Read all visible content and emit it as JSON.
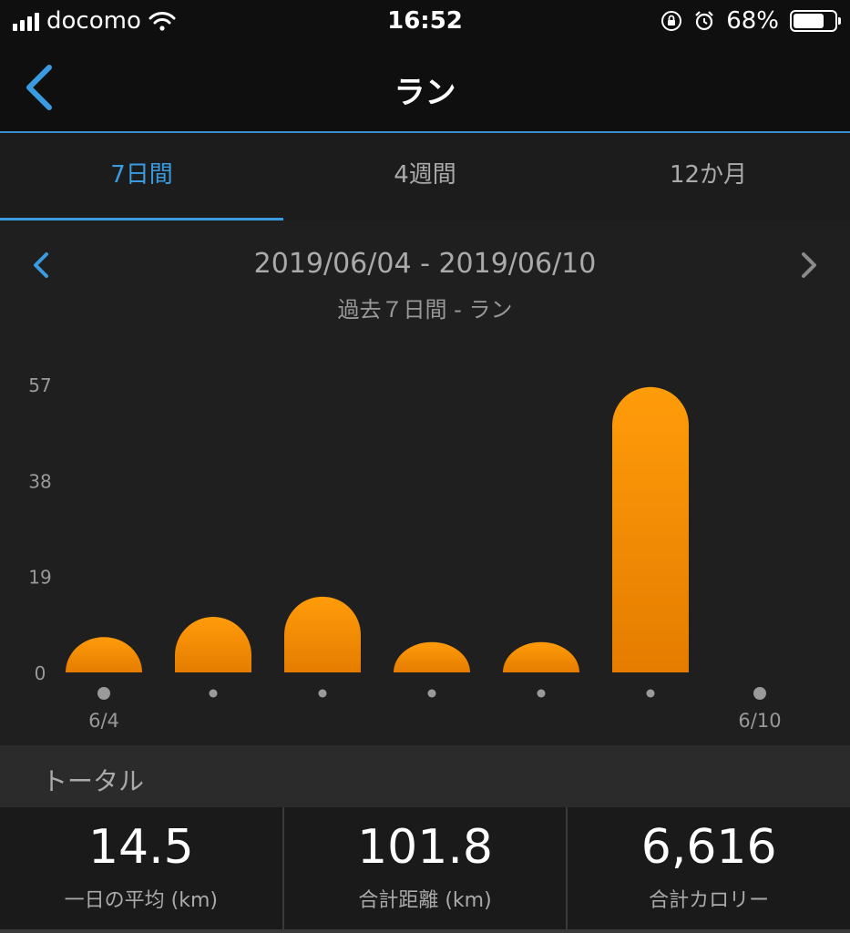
{
  "status_bar": {
    "carrier": "docomo",
    "time": "16:52",
    "battery": "68%",
    "battery_level": 0.68
  },
  "nav": {
    "back_icon": "chevron-left-icon",
    "title": "ラン"
  },
  "tabs": [
    {
      "label": "7日間",
      "active": true
    },
    {
      "label": "4週間",
      "active": false
    },
    {
      "label": "12か月",
      "active": false
    }
  ],
  "range": {
    "dates": "2019/06/04 - 2019/06/10",
    "subtitle": "過去７日間 - ラン"
  },
  "chart_data": {
    "type": "bar",
    "categories": [
      "6/4",
      "",
      "",
      "",
      "",
      "",
      "6/10"
    ],
    "values": [
      7,
      11,
      15,
      6,
      6,
      56.5,
      0
    ],
    "yticks": [
      0,
      19,
      38,
      57
    ],
    "ylim": [
      0,
      57
    ],
    "bar_color_top": "#ff9c0a",
    "bar_color_bottom": "#e57c00",
    "grid": false
  },
  "totals": {
    "header": "トータル",
    "items": [
      {
        "value": "14.5",
        "label": "一日の平均 (km)"
      },
      {
        "value": "101.8",
        "label": "合計距離 (km)"
      },
      {
        "value": "6,616",
        "label": "合計カロリー"
      }
    ]
  },
  "colors": {
    "accent": "#3a9be0",
    "background": "#1f1f1f"
  }
}
